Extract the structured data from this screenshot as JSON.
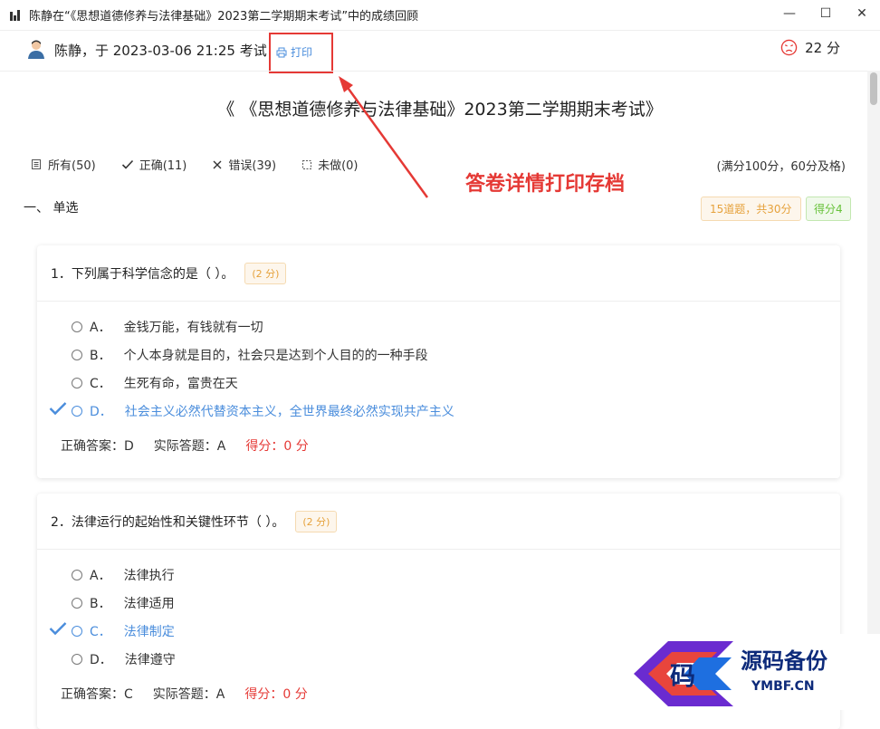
{
  "window": {
    "title": "陈静在“《思想道德修养与法律基础》2023第二学期期末考试”中的成绩回顾"
  },
  "header": {
    "user_line": "陈静，于 2023-03-06 21:25 考试",
    "print_label": "打印",
    "score": "22 分"
  },
  "exam_title": "《 《思想道德修养与法律基础》2023第二学期期末考试》",
  "filters": [
    {
      "label": "所有(50)",
      "icon": "document-icon"
    },
    {
      "label": "正确(11)",
      "icon": "check-icon"
    },
    {
      "label": "错误(39)",
      "icon": "cross-icon"
    },
    {
      "label": "未做(0)",
      "icon": "dashed-square-icon"
    }
  ],
  "full_score": "(满分100分，60分及格)",
  "annotation": "答卷详情打印存档",
  "section": {
    "title": "一、 单选",
    "count_badge": "15道题，共30分",
    "score_badge": "得分4"
  },
  "questions": [
    {
      "title": "1．下列属于科学信念的是（ ）。",
      "points": "(2 分)",
      "options": [
        {
          "letter": "A．",
          "text": "金钱万能，有钱就有一切"
        },
        {
          "letter": "B．",
          "text": "个人本身就是目的，社会只是达到个人目的的一种手段"
        },
        {
          "letter": "C．",
          "text": "生死有命，富贵在天"
        },
        {
          "letter": "D．",
          "text": "社会主义必然代替资本主义，全世界最终必然实现共产主义"
        }
      ],
      "correct_answer": "正确答案：D",
      "actual_answer": "实际答题：A",
      "score": "得分：0 分"
    },
    {
      "title": "2．法律运行的起始性和关键性环节（ ）。",
      "points": "(2 分)",
      "options": [
        {
          "letter": "A．",
          "text": "法律执行"
        },
        {
          "letter": "B．",
          "text": "法律适用"
        },
        {
          "letter": "C．",
          "text": "法律制定"
        },
        {
          "letter": "D．",
          "text": "法律遵守"
        }
      ],
      "correct_answer": "正确答案：C",
      "actual_answer": "实际答题：A",
      "score": "得分：0 分"
    }
  ],
  "watermark": {
    "brand": "码",
    "name": "源码备份",
    "site": "YMBF.CN"
  },
  "colors": {
    "accent": "#4a8ddc",
    "red": "#e53935",
    "warning": "#e6a23c",
    "success": "#67c23a"
  }
}
